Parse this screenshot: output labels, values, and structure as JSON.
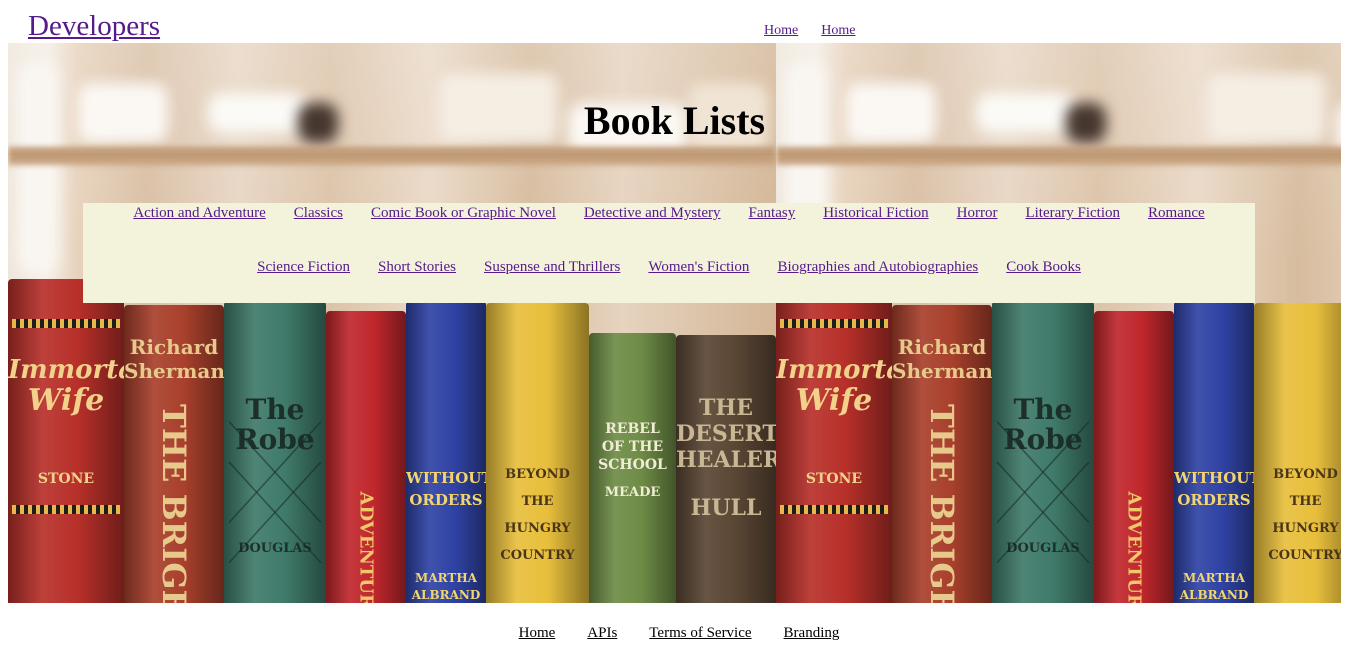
{
  "header": {
    "brand": "Developers",
    "nav": [
      "Home",
      "Home"
    ]
  },
  "hero": {
    "title": "Book Lists"
  },
  "categories": {
    "row1": [
      "Action and Adventure",
      "Classics",
      "Comic Book or Graphic Novel",
      "Detective and Mystery",
      "Fantasy",
      "Historical Fiction",
      "Horror",
      "Literary Fiction",
      "Romance"
    ],
    "row2": [
      "Science Fiction",
      "Short Stories",
      "Suspense and Thrillers",
      "Women's Fiction",
      "Biographies and Autobiographies",
      "Cook Books"
    ]
  },
  "footer": {
    "links": [
      "Home",
      "APIs",
      "Terms of Service",
      "Branding"
    ]
  },
  "books": [
    {
      "title": "Immortal Wife",
      "author": "STONE"
    },
    {
      "title": "Richard Sherman",
      "subtitle": "THE BRIGH"
    },
    {
      "title": "The Robe",
      "author": "DOUGLAS"
    },
    {
      "title": "ADVENTURE"
    },
    {
      "title": "WITHOUT ORDERS",
      "author": "MARTHA ALBRAND"
    },
    {
      "title": "BEYOND THE HUNGRY COUNTRY"
    },
    {
      "title": "REBEL OF THE SCHOOL",
      "author": "MEADE"
    },
    {
      "title": "THE DESERT HEALER",
      "author": "HULL"
    }
  ],
  "colors": {
    "link": "#551a8b",
    "panel": "#f3f3dc"
  }
}
